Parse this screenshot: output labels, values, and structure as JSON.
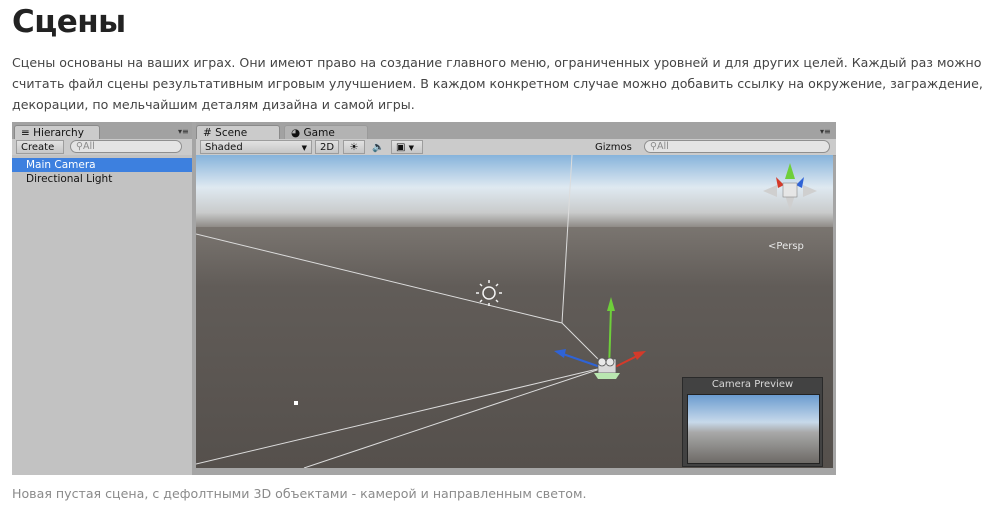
{
  "article": {
    "title": "Сцены",
    "intro": "Сцены основаны на ваших играх. Они имеют право на создание главного меню, ограниченных уровней и для других целей. Каждый раз можно считать файл сцены результативным игровым улучшением. В каждом конкретном случае можно добавить ссылку на окружение, заграждение, декорации, по мельчайшим деталям дизайна и самой игры.",
    "caption": "Новая пустая сцена, с дефолтными 3D объектами - камерой и направленным светом."
  },
  "hierarchy": {
    "tab_label": "Hierarchy",
    "create_label": "Create",
    "search_placeholder": "All",
    "items": [
      {
        "label": "Main Camera",
        "selected": true
      },
      {
        "label": "Directional Light",
        "selected": false
      }
    ]
  },
  "scene": {
    "tabs": [
      {
        "label": "Scene",
        "icon": "hash-icon",
        "active": true
      },
      {
        "label": "Game",
        "icon": "pacman-icon",
        "active": false
      }
    ],
    "toolbar": {
      "shading_mode": "Shaded",
      "mode_2d": "2D",
      "gizmos_label": "Gizmos",
      "search_placeholder": "All"
    },
    "projection_label": "Persp",
    "camera_preview_title": "Camera Preview"
  },
  "colors": {
    "selection": "#3d80df",
    "axis_x": "#d43a2a",
    "axis_y": "#6ecf3a",
    "axis_z": "#2f63d6"
  }
}
